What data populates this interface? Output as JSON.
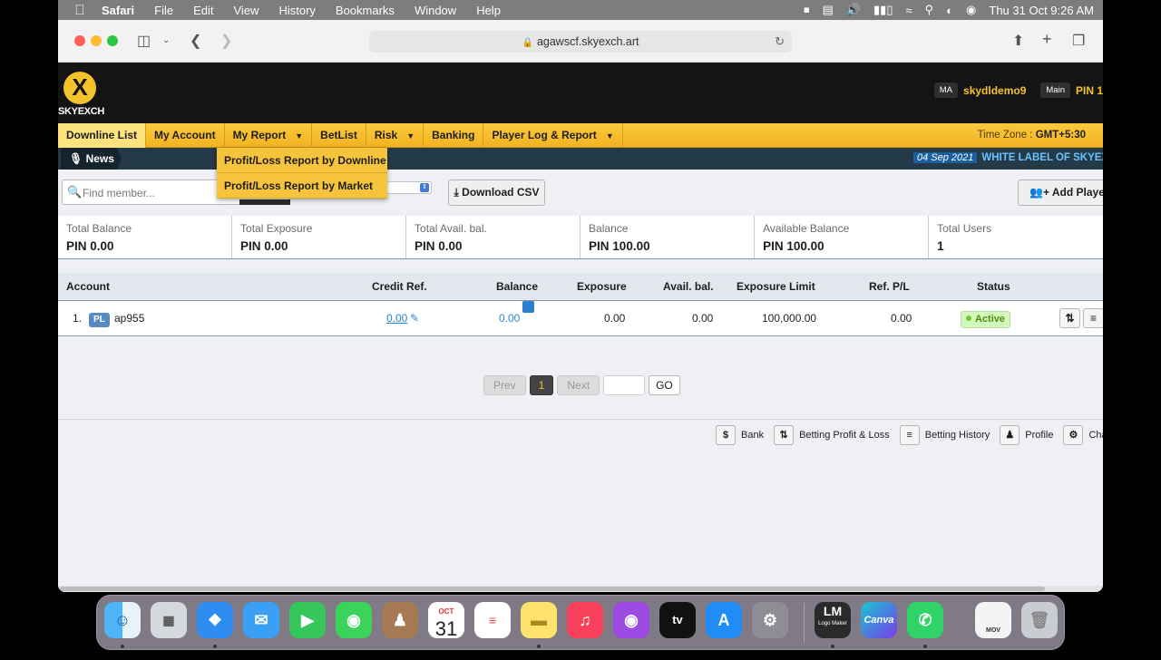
{
  "menubar": {
    "app": "Safari",
    "items": [
      "File",
      "Edit",
      "View",
      "History",
      "Bookmarks",
      "Window",
      "Help"
    ],
    "clock": "Thu 31 Oct  9:26 AM"
  },
  "browser": {
    "url": "agawscf.skyexch.art"
  },
  "site": {
    "logo_text": "SKYEXCH",
    "role_tag": "MA",
    "username": "skydldemo9",
    "wallet_tag": "Main",
    "currency_partial": "PIN 1"
  },
  "nav": {
    "items": [
      {
        "label": "Downline List",
        "caret": false
      },
      {
        "label": "My Account",
        "caret": false
      },
      {
        "label": "My Report",
        "caret": true
      },
      {
        "label": "BetList",
        "caret": false
      },
      {
        "label": "Risk",
        "caret": true
      },
      {
        "label": "Banking",
        "caret": false
      },
      {
        "label": "Player Log & Report",
        "caret": true
      }
    ],
    "timezone_label": "Time Zone :",
    "timezone_value": "GMT+5:30"
  },
  "dropdown": {
    "items": [
      "Profit/Loss Report by Downline",
      "Profit/Loss Report by Market"
    ]
  },
  "news": {
    "label": "News",
    "date": "04 Sep 2021",
    "headline": "WHITE LABEL OF SKYEXCH"
  },
  "toolbar": {
    "search_placeholder": "Find member...",
    "download_label": "Download CSV",
    "add_player_label": "Add Player"
  },
  "summary": [
    {
      "label": "Total Balance",
      "value": "PIN 0.00"
    },
    {
      "label": "Total Exposure",
      "value": "PIN 0.00"
    },
    {
      "label": "Total Avail. bal.",
      "value": "PIN 0.00"
    },
    {
      "label": "Balance",
      "value": "PIN 100.00"
    },
    {
      "label": "Available Balance",
      "value": "PIN 100.00"
    },
    {
      "label": "Total Users",
      "value": "1"
    }
  ],
  "table": {
    "headers": {
      "account": "Account",
      "credit": "Credit Ref.",
      "balance": "Balance",
      "exposure": "Exposure",
      "avail": "Avail. bal.",
      "limit": "Exposure Limit",
      "refpl": "Ref. P/L",
      "status": "Status"
    },
    "rows": [
      {
        "index": "1.",
        "tag": "PL",
        "account": "ap955",
        "credit": "0.00",
        "balance": "0.00",
        "exposure": "0.00",
        "avail": "0.00",
        "limit": "100,000.00",
        "refpl": "0.00",
        "status": "Active"
      }
    ]
  },
  "pagination": {
    "prev": "Prev",
    "current": "1",
    "next": "Next",
    "go": "GO"
  },
  "legend": [
    "Bank",
    "Betting Profit & Loss",
    "Betting History",
    "Profile",
    "Cha"
  ],
  "dock": {
    "calendar_month": "OCT",
    "calendar_day": "31",
    "logo_maker": "Logo Maker",
    "canva": "Canva",
    "mov": "MOV"
  }
}
